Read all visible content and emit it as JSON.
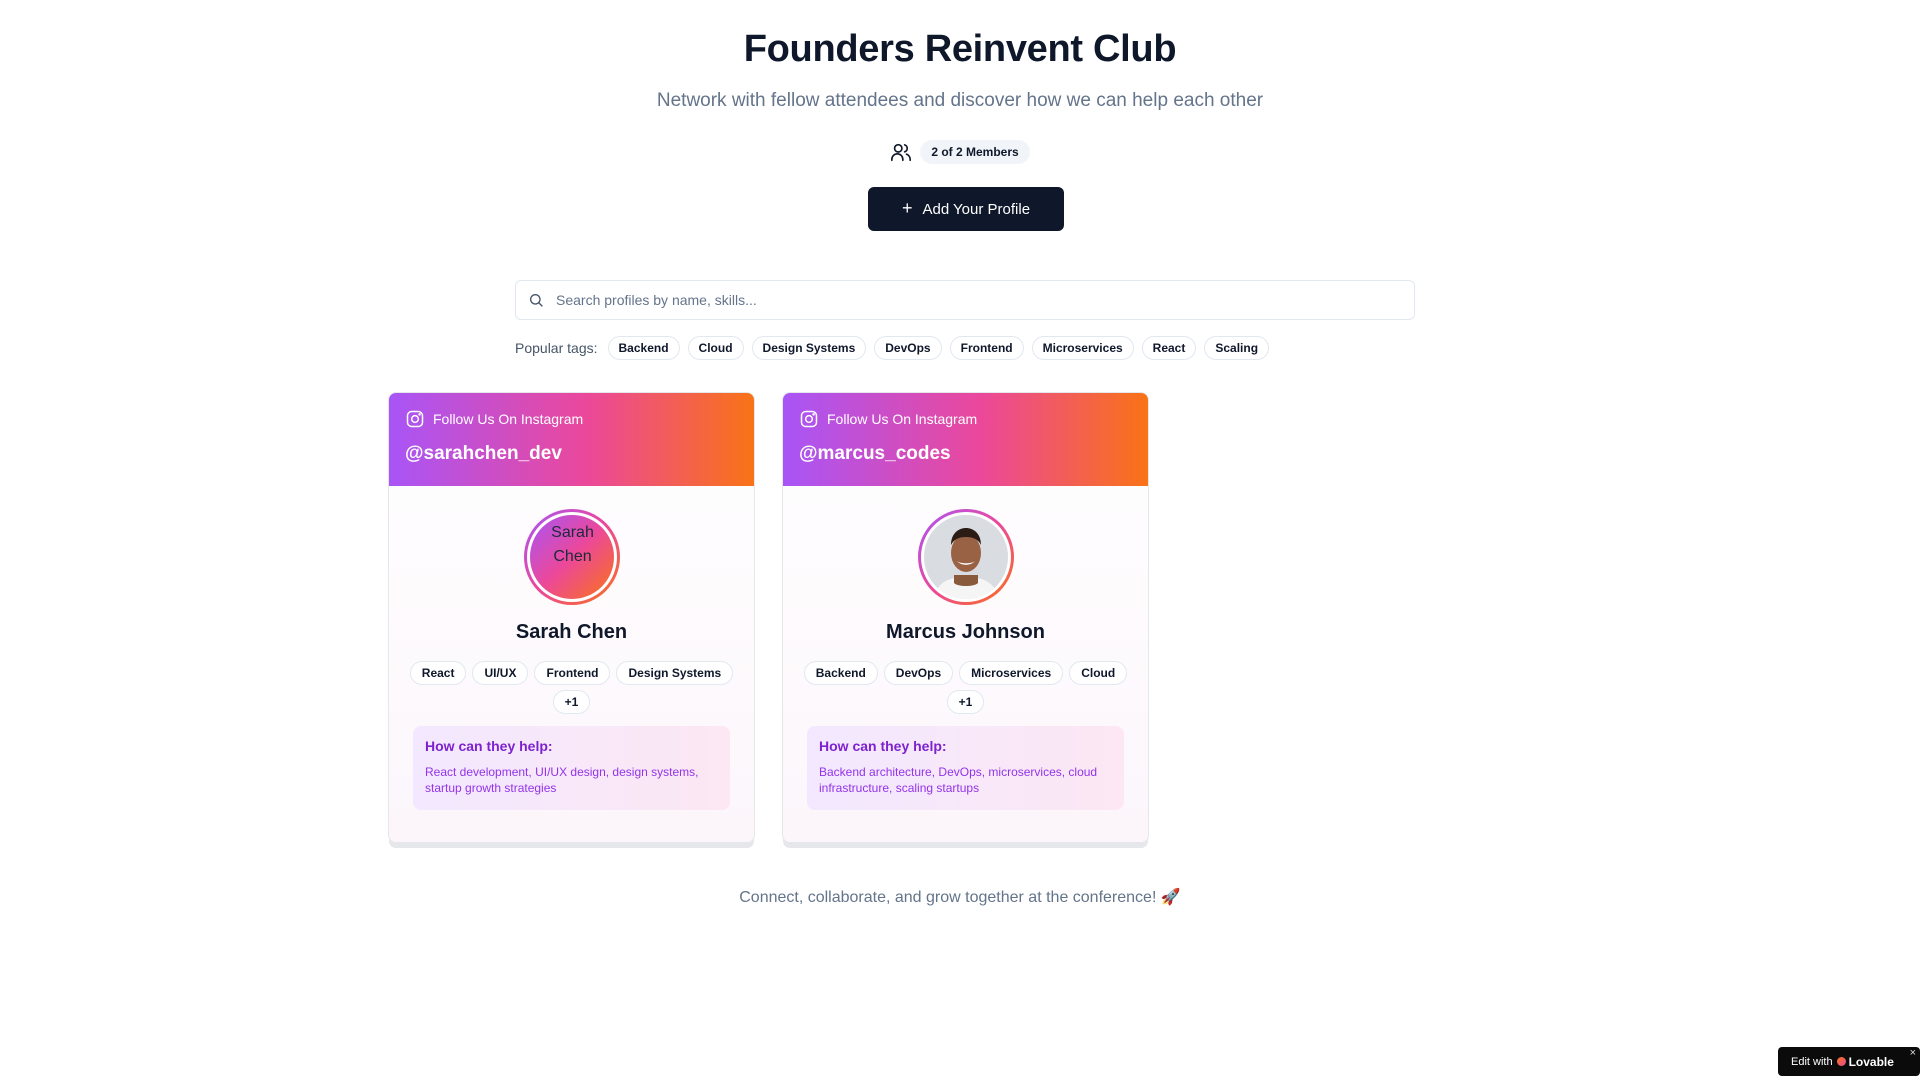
{
  "header": {
    "title": "Founders Reinvent Club",
    "subtitle": "Network with fellow attendees and discover how we can help each other",
    "members_badge": "2 of 2 Members",
    "add_profile_label": "Add Your Profile"
  },
  "search": {
    "placeholder": "Search profiles by name, skills...",
    "popular_label": "Popular tags:",
    "tags": [
      "Backend",
      "Cloud",
      "Design Systems",
      "DevOps",
      "Frontend",
      "Microservices",
      "React",
      "Scaling"
    ]
  },
  "profiles": [
    {
      "follow_label": "Follow Us On Instagram",
      "handle": "@sarahchen_dev",
      "avatar_alt": "Sarah Chen",
      "name": "Sarah Chen",
      "skills": [
        "React",
        "UI/UX",
        "Frontend",
        "Design Systems",
        "+1"
      ],
      "help_title": "How can they help:",
      "help_text": "React development, UI/UX design, design systems, startup growth strategies"
    },
    {
      "follow_label": "Follow Us On Instagram",
      "handle": "@marcus_codes",
      "name": "Marcus Johnson",
      "skills": [
        "Backend",
        "DevOps",
        "Microservices",
        "Cloud",
        "+1"
      ],
      "help_title": "How can they help:",
      "help_text": "Backend architecture, DevOps, microservices, cloud infrastructure, scaling startups"
    }
  ],
  "footer": "Connect, collaborate, and grow together at the conference! 🚀",
  "badge": {
    "edit_with": "Edit with",
    "brand": "Lovable",
    "close": "×"
  },
  "colors": {
    "primary": "#0f172a",
    "gradient_start": "#a855f7",
    "gradient_mid": "#ec4899",
    "gradient_end": "#f97316",
    "help_text": "#9333ea"
  }
}
